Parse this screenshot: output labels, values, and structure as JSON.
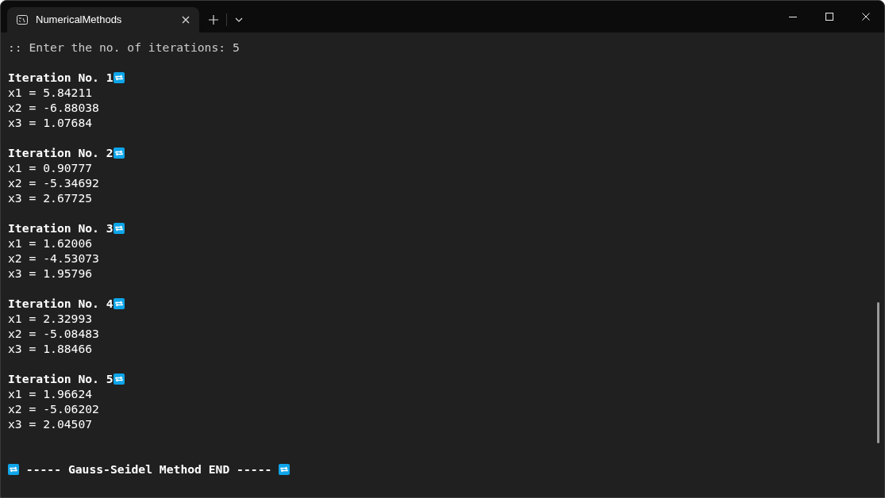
{
  "window": {
    "tab_title": "NumericalMethods"
  },
  "console": {
    "prompt": ":: Enter the no. of iterations: 5",
    "iterations": [
      {
        "heading": "Iteration No. 1",
        "values": [
          "x1 = 5.84211",
          "x2 = -6.88038",
          "x3 = 1.07684"
        ]
      },
      {
        "heading": "Iteration No. 2",
        "values": [
          "x1 = 0.90777",
          "x2 = -5.34692",
          "x3 = 2.67725"
        ]
      },
      {
        "heading": "Iteration No. 3",
        "values": [
          "x1 = 1.62006",
          "x2 = -4.53073",
          "x3 = 1.95796"
        ]
      },
      {
        "heading": "Iteration No. 4",
        "values": [
          "x1 = 2.32993",
          "x2 = -5.08483",
          "x3 = 1.88466"
        ]
      },
      {
        "heading": "Iteration No. 5",
        "values": [
          "x1 = 1.96624",
          "x2 = -5.06202",
          "x3 = 2.04507"
        ]
      }
    ],
    "end_line": " ----- Gauss-Seidel Method END ----- "
  }
}
